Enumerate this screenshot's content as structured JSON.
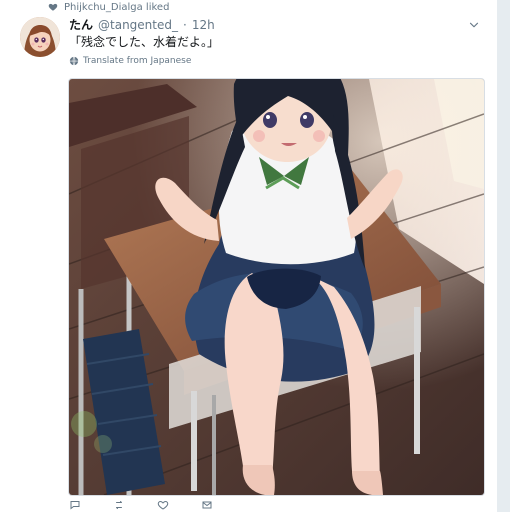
{
  "context": {
    "label": "Phijkchu_Dialga liked",
    "icon": "heart-icon"
  },
  "tweet": {
    "author_name": "たん",
    "author_handle": "@tangented_",
    "separator": "·",
    "time": "12h",
    "text": "「残念でした、水着だよ。」",
    "translate_label": "Translate from Japanese",
    "caret_icon": "chevron-down-icon"
  },
  "actions": {
    "reply_count": "",
    "retweet_count": "",
    "like_count": "",
    "dm_count": ""
  },
  "colors": {
    "background": "#e6ecf0",
    "card": "#ffffff",
    "text": "#14171a",
    "muted": "#657786"
  }
}
